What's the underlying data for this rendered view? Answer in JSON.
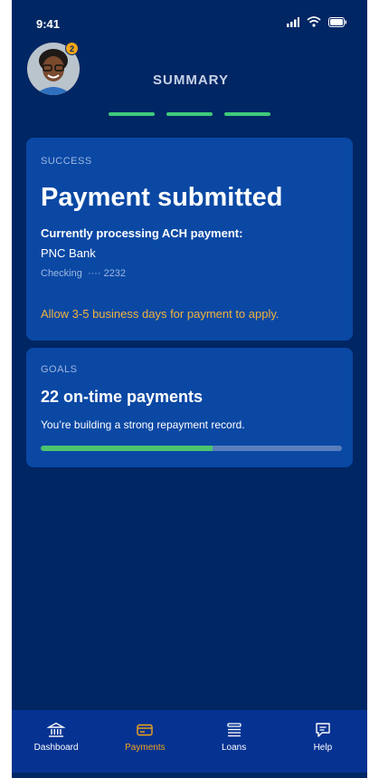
{
  "status_bar": {
    "time": "9:41"
  },
  "profile": {
    "badge_count": "2"
  },
  "header": {
    "title": "SUMMARY",
    "progress_steps": 3
  },
  "success_card": {
    "eyebrow": "SUCCESS",
    "headline": "Payment submitted",
    "subhead": "Currently processing ACH payment:",
    "bank_name": "PNC Bank",
    "account_type": "Checking",
    "account_mask": "···· 2232",
    "notice": "Allow 3-5 business days for payment to apply."
  },
  "goals_card": {
    "eyebrow": "GOALS",
    "title": "22 on-time payments",
    "description": "You’re building a strong repayment record.",
    "progress_fraction": 0.57
  },
  "tab_bar": {
    "tabs": [
      {
        "label": "Dashboard",
        "icon": "bank-icon",
        "active": false
      },
      {
        "label": "Payments",
        "icon": "card-icon",
        "active": true
      },
      {
        "label": "Loans",
        "icon": "list-icon",
        "active": false
      },
      {
        "label": "Help",
        "icon": "chat-icon",
        "active": false
      }
    ]
  },
  "colors": {
    "background": "#002664",
    "card": "#0a48a4",
    "accent_green": "#3fca7a",
    "accent_orange": "#f2a517",
    "notice_text": "#f2b33b"
  }
}
